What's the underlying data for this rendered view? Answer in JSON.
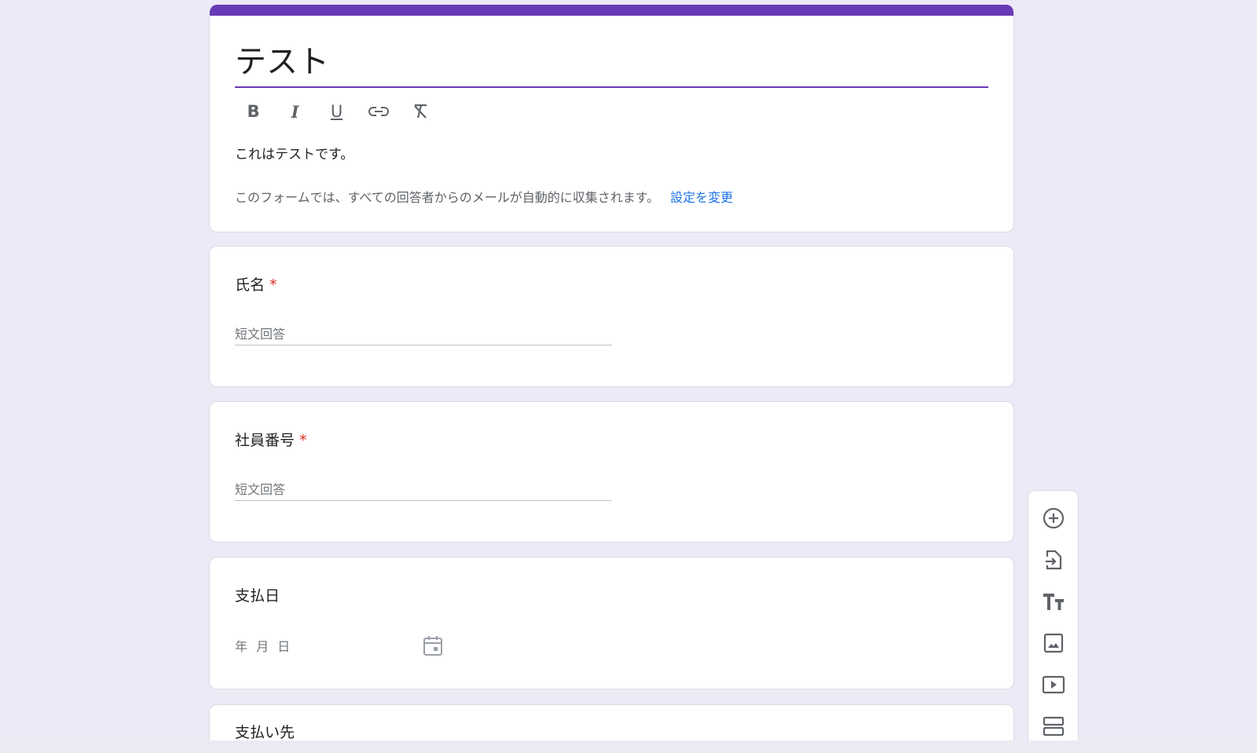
{
  "form": {
    "title": "テスト",
    "description": "これはテストです。",
    "email_notice": "このフォームでは、すべての回答者からのメールが自動的に収集されます。",
    "change_settings_link": "設定を変更",
    "accent_color": "#673ab7"
  },
  "toolbar": {
    "bold": "B",
    "italic": "I",
    "underline": "U"
  },
  "questions": [
    {
      "title": "氏名",
      "required_mark": "*",
      "placeholder": "短文回答"
    },
    {
      "title": "社員番号",
      "required_mark": "*",
      "placeholder": "短文回答"
    },
    {
      "title": "支払日",
      "placeholder": "年 月 日"
    },
    {
      "title": "支払い先"
    }
  ],
  "side_toolbar": [
    "add-question-icon",
    "import-questions-icon",
    "add-title-icon",
    "add-image-icon",
    "add-video-icon",
    "add-section-icon"
  ]
}
